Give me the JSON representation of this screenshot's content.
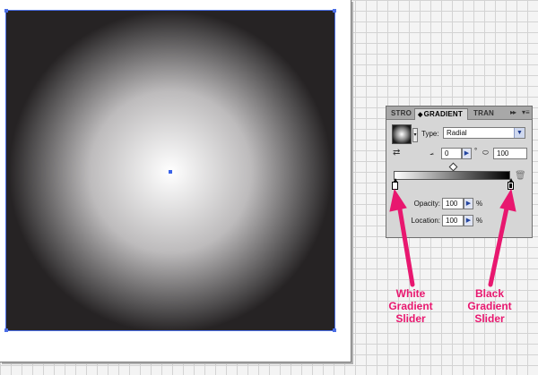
{
  "gradient_panel": {
    "tabs": [
      {
        "label": "STRO"
      },
      {
        "label": "GRADIENT"
      },
      {
        "label": "TRAN"
      }
    ],
    "more_icon": "double-chevron-right-icon",
    "menu_icon": "panel-menu-icon",
    "type_label": "Type:",
    "type_value": "Radial",
    "angle_value": "0",
    "degree_symbol": "°",
    "aspect_value": "100",
    "opacity_label": "Opacity:",
    "opacity_value": "100",
    "location_label": "Location:",
    "location_value": "100",
    "percent_symbol": "%"
  },
  "callouts": {
    "white": "White\nGradient\nSlider",
    "black": "Black\nGradient\nSlider"
  },
  "colors": {
    "annotation": "#e8176f",
    "selection": "#4b6ee6"
  }
}
